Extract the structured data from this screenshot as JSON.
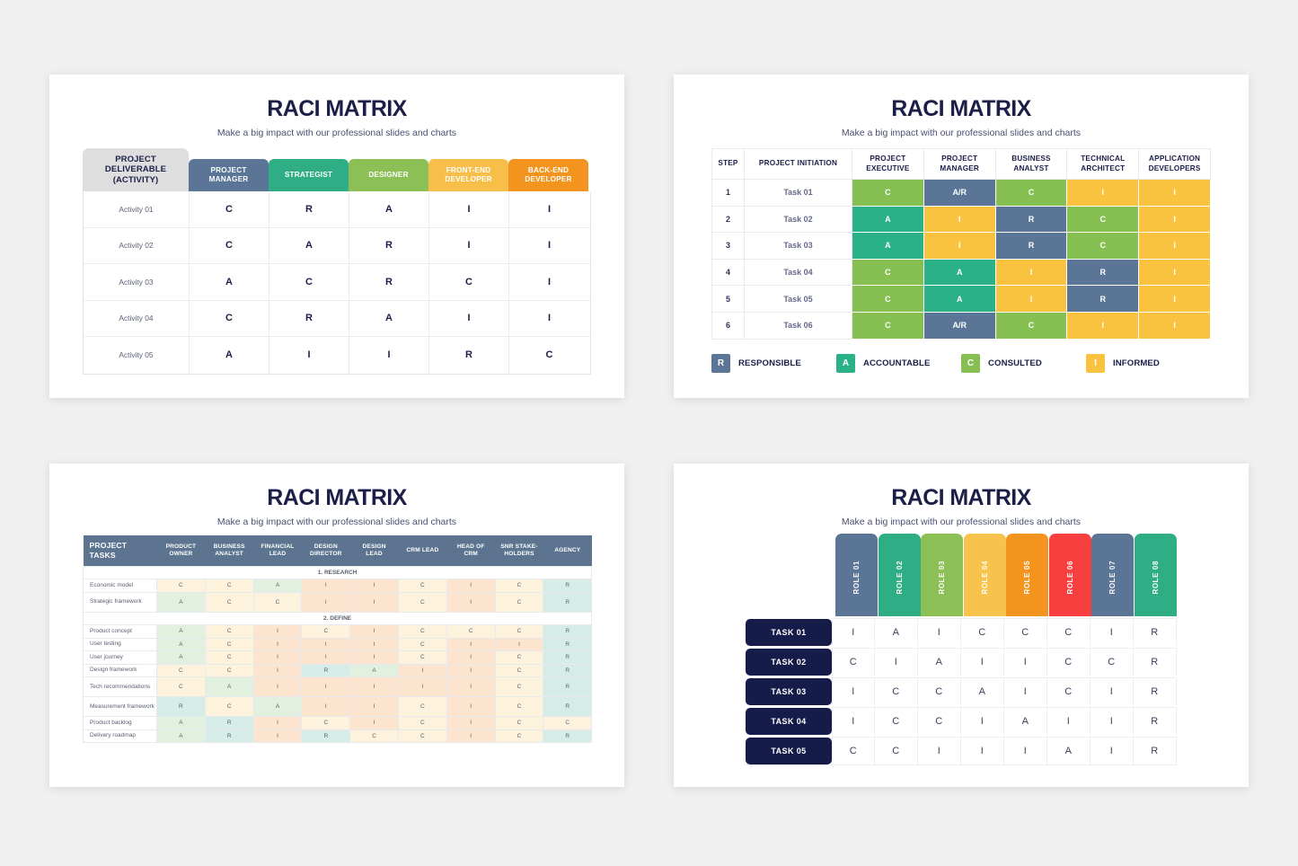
{
  "slides": {
    "top_left": {
      "title": "RACI MATRIX",
      "subtitle": "Make a big impact with our professional slides and charts",
      "corner_label": "PROJECT DELIVERABLE (ACTIVITY)",
      "corner_lines": [
        "PROJECT",
        "DELIVERABLE",
        "(ACTIVITY)"
      ],
      "columns": [
        {
          "label": "PROJECT MANAGER",
          "lines": [
            "PROJECT",
            "MANAGER"
          ],
          "color": "#5a7596"
        },
        {
          "label": "STRATEGIST",
          "lines": [
            "STRATEGIST"
          ],
          "color": "#2fae85"
        },
        {
          "label": "DESIGNER",
          "lines": [
            "DESIGNER"
          ],
          "color": "#8cc056"
        },
        {
          "label": "FRONT-END DEVELOPER",
          "lines": [
            "FRONT-END",
            "DEVELOPER"
          ],
          "color": "#f7bf4a"
        },
        {
          "label": "BACK-END DEVELOPER",
          "lines": [
            "BACK-END",
            "DEVELOPER"
          ],
          "color": "#f2941e"
        }
      ],
      "rows": [
        {
          "label": "Activity 01",
          "values": [
            "C",
            "R",
            "A",
            "I",
            "I"
          ]
        },
        {
          "label": "Activity 02",
          "values": [
            "C",
            "A",
            "R",
            "I",
            "I"
          ]
        },
        {
          "label": "Activity 03",
          "values": [
            "A",
            "C",
            "R",
            "C",
            "I"
          ]
        },
        {
          "label": "Activity 04",
          "values": [
            "C",
            "R",
            "A",
            "I",
            "I"
          ]
        },
        {
          "label": "Activity 05",
          "values": [
            "A",
            "I",
            "I",
            "R",
            "C"
          ]
        }
      ]
    },
    "top_right": {
      "title": "RACI MATRIX",
      "subtitle": "Make a big impact with our professional slides and charts",
      "headers": [
        {
          "label": "STEP",
          "lines": [
            "STEP"
          ]
        },
        {
          "label": "PROJECT INITIATION",
          "lines": [
            "PROJECT INITIATION"
          ]
        },
        {
          "label": "PROJECT EXECUTIVE",
          "lines": [
            "PROJECT",
            "EXECUTIVE"
          ]
        },
        {
          "label": "PROJECT MANAGER",
          "lines": [
            "PROJECT",
            "MANAGER"
          ]
        },
        {
          "label": "BUSINESS ANALYST",
          "lines": [
            "BUSINESS",
            "ANALYST"
          ]
        },
        {
          "label": "TECHNICAL ARCHITECT",
          "lines": [
            "TECHNICAL",
            "ARCHITECT"
          ]
        },
        {
          "label": "APPLICATION DEVELOPERS",
          "lines": [
            "APPLICATION",
            "DEVELOPERS"
          ]
        }
      ],
      "rows": [
        {
          "step": "1",
          "task": "Task 01",
          "values": [
            "C",
            "A/R",
            "C",
            "I",
            "I"
          ]
        },
        {
          "step": "2",
          "task": "Task 02",
          "values": [
            "A",
            "I",
            "R",
            "C",
            "I"
          ]
        },
        {
          "step": "3",
          "task": "Task 03",
          "values": [
            "A",
            "I",
            "R",
            "C",
            "I"
          ]
        },
        {
          "step": "4",
          "task": "Task 04",
          "values": [
            "C",
            "A",
            "I",
            "R",
            "I"
          ]
        },
        {
          "step": "5",
          "task": "Task 05",
          "values": [
            "C",
            "A",
            "I",
            "R",
            "I"
          ]
        },
        {
          "step": "6",
          "task": "Task 06",
          "values": [
            "C",
            "A/R",
            "C",
            "I",
            "I"
          ]
        }
      ],
      "legend": [
        {
          "key": "R",
          "label": "RESPONSIBLE",
          "color": "#5a7596"
        },
        {
          "key": "A",
          "label": "ACCOUNTABLE",
          "color": "#2ab188"
        },
        {
          "key": "C",
          "label": "CONSULTED",
          "color": "#86bf52"
        },
        {
          "key": "I",
          "label": "INFORMED",
          "color": "#fac33f"
        }
      ]
    },
    "bottom_left": {
      "title": "RACI MATRIX",
      "subtitle": "Make a big impact with our professional slides and charts",
      "headers": [
        {
          "label": "PROJECT TASKS",
          "lines": [
            "PROJECT",
            "TASKS"
          ]
        },
        {
          "label": "PRODUCT OWNER",
          "lines": [
            "PRODUCT",
            "OWNER"
          ]
        },
        {
          "label": "BUSINESS ANALYST",
          "lines": [
            "BUSINESS",
            "ANALYST"
          ]
        },
        {
          "label": "FINANCIAL LEAD",
          "lines": [
            "FINANCIAL",
            "LEAD"
          ]
        },
        {
          "label": "DESIGN DIRECTOR",
          "lines": [
            "DESIGN",
            "DIRECTOR"
          ]
        },
        {
          "label": "DESIGN LEAD",
          "lines": [
            "DESIGN",
            "LEAD"
          ]
        },
        {
          "label": "CRM LEAD",
          "lines": [
            "CRM LEAD"
          ]
        },
        {
          "label": "HEAD OF CRM",
          "lines": [
            "HEAD OF",
            "CRM"
          ]
        },
        {
          "label": "SNR STAKE-HOLDERS",
          "lines": [
            "SNR STAKE-",
            "HOLDERS"
          ]
        },
        {
          "label": "AGENCY",
          "lines": [
            "AGENCY"
          ]
        }
      ],
      "sections": [
        {
          "title": "1. RESEARCH",
          "rows": [
            {
              "label": "Economic model",
              "tall": false,
              "values": [
                "C",
                "C",
                "A",
                "I",
                "I",
                "C",
                "I",
                "C",
                "R"
              ]
            },
            {
              "label": "Strategic framework",
              "tall": true,
              "values": [
                "A",
                "C",
                "C",
                "I",
                "I",
                "C",
                "I",
                "C",
                "R"
              ]
            }
          ]
        },
        {
          "title": "2. DEFINE",
          "rows": [
            {
              "label": "Product concept",
              "tall": false,
              "values": [
                "A",
                "C",
                "I",
                "C",
                "I",
                "C",
                "C",
                "C",
                "R"
              ]
            },
            {
              "label": "User testing",
              "tall": false,
              "values": [
                "A",
                "C",
                "I",
                "I",
                "I",
                "C",
                "I",
                "I",
                "R"
              ]
            },
            {
              "label": "User journey",
              "tall": false,
              "values": [
                "A",
                "C",
                "I",
                "I",
                "I",
                "C",
                "I",
                "C",
                "R"
              ]
            },
            {
              "label": "Design framework",
              "tall": false,
              "values": [
                "C",
                "C",
                "I",
                "R",
                "A",
                "I",
                "I",
                "C",
                "R"
              ]
            },
            {
              "label": "Tech recommendations",
              "tall": true,
              "values": [
                "C",
                "A",
                "I",
                "I",
                "I",
                "I",
                "I",
                "C",
                "R"
              ]
            },
            {
              "label": "Measurement framework",
              "tall": true,
              "values": [
                "R",
                "C",
                "A",
                "I",
                "I",
                "C",
                "I",
                "C",
                "R"
              ]
            },
            {
              "label": "Product backlog",
              "tall": false,
              "values": [
                "A",
                "R",
                "I",
                "C",
                "I",
                "C",
                "I",
                "C",
                "C"
              ]
            },
            {
              "label": "Delivery roadmap",
              "tall": false,
              "values": [
                "A",
                "R",
                "I",
                "R",
                "C",
                "C",
                "I",
                "C",
                "R"
              ]
            }
          ]
        }
      ]
    },
    "bottom_right": {
      "title": "RACI MATRIX",
      "subtitle": "Make a big impact with our professional slides and charts",
      "roles": [
        {
          "label": "ROLE 01",
          "color": "#5a7596"
        },
        {
          "label": "ROLE 02",
          "color": "#2fae85"
        },
        {
          "label": "ROLE 03",
          "color": "#8cc056"
        },
        {
          "label": "ROLE 04",
          "color": "#f7c34d"
        },
        {
          "label": "ROLE 05",
          "color": "#f2941e"
        },
        {
          "label": "ROLE 06",
          "color": "#f73f3f"
        },
        {
          "label": "ROLE 07",
          "color": "#5a7596"
        },
        {
          "label": "ROLE 08",
          "color": "#2fae85"
        }
      ],
      "rows": [
        {
          "label": "TASK 01",
          "values": [
            "I",
            "A",
            "I",
            "C",
            "C",
            "C",
            "I",
            "R"
          ]
        },
        {
          "label": "TASK 02",
          "values": [
            "C",
            "I",
            "A",
            "I",
            "I",
            "C",
            "C",
            "R"
          ]
        },
        {
          "label": "TASK 03",
          "values": [
            "I",
            "C",
            "C",
            "A",
            "I",
            "C",
            "I",
            "R"
          ]
        },
        {
          "label": "TASK 04",
          "values": [
            "I",
            "C",
            "C",
            "I",
            "A",
            "I",
            "I",
            "R"
          ]
        },
        {
          "label": "TASK 05",
          "values": [
            "C",
            "C",
            "I",
            "I",
            "I",
            "A",
            "I",
            "R"
          ]
        }
      ]
    }
  }
}
